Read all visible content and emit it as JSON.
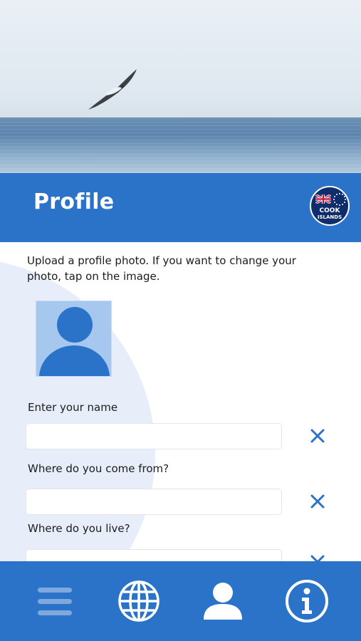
{
  "header": {
    "title": "Profile",
    "badge": {
      "line1": "COOK",
      "line2": "ISLANDS"
    }
  },
  "profile": {
    "instruction": "Upload a profile photo. If you want to change your photo, tap on the image.",
    "fields": [
      {
        "label": "Enter your name",
        "value": "",
        "placeholder": ""
      },
      {
        "label": "Where do you come from?",
        "value": "",
        "placeholder": ""
      },
      {
        "label": "Where do you live?",
        "value": "",
        "placeholder": ""
      }
    ]
  },
  "nav": {
    "items": [
      {
        "icon": "menu-icon"
      },
      {
        "icon": "globe-icon"
      },
      {
        "icon": "user-icon",
        "active": true
      },
      {
        "icon": "info-icon"
      }
    ]
  },
  "colors": {
    "brand_blue": "#2a73c9",
    "badge_navy": "#0f2d6b",
    "avatar_bg": "#a6c7ee",
    "nav_inactive": "#7fa9de"
  }
}
